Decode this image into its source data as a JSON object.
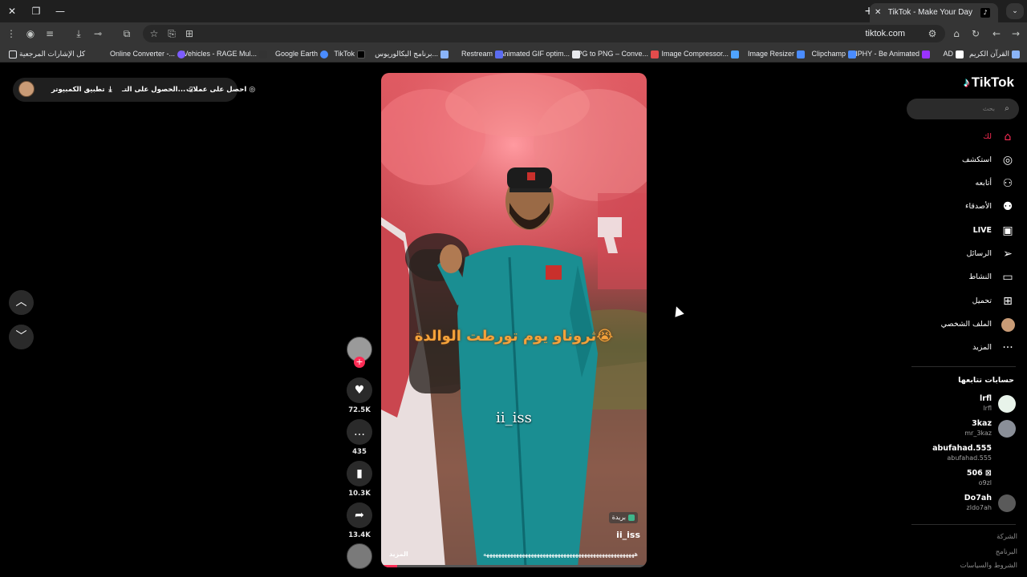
{
  "browser": {
    "tab_title": "TikTok - Make Your Day",
    "tab_favicon": "tiktok-icon",
    "url": "tiktok.com",
    "new_tab": "+",
    "tab_close": "✕"
  },
  "bookmarks": [
    {
      "label": "القرآن الكريم",
      "icon": "globe-icon",
      "color": "#8ab4f8"
    },
    {
      "label": "AD",
      "icon": "s-icon",
      "color": "#ffffff"
    },
    {
      "label": "GIPHY - Be Animated",
      "icon": "giphy-icon",
      "color": "#9933ff"
    },
    {
      "label": "Clipchamp",
      "icon": "clipchamp-icon",
      "color": "#4a8cff"
    },
    {
      "label": "Image Resizer",
      "icon": "resizer-icon",
      "color": "#e8eaed"
    },
    {
      "label": "Image Compressor...",
      "icon": "compressor-icon",
      "color": "#4fa3ff"
    },
    {
      "label": "JPG to PNG – Conve...",
      "icon": "convert-icon",
      "color": "#e34c4c"
    },
    {
      "label": "Animated GIF optim...",
      "icon": "gif-icon",
      "color": "#e8eaed"
    },
    {
      "label": "Restream",
      "icon": "restream-icon",
      "color": "#5b6cf0"
    },
    {
      "label": "برنامج البكالوريوس...",
      "icon": "edu-icon",
      "color": "#8ab4f8"
    },
    {
      "label": "TikTok",
      "icon": "tiktok-icon",
      "color": "#000000"
    },
    {
      "label": "Google Earth",
      "icon": "earth-icon",
      "color": "#4a8cff"
    },
    {
      "label": "Vehicles - RAGE Mul...",
      "icon": "rage-icon",
      "color": "#333333"
    },
    {
      "label": "Online Converter -...",
      "icon": "converter-icon",
      "color": "#7c5cff"
    },
    {
      "label": "كل الإشارات المرجعية",
      "icon": "folder-icon",
      "color": "#e8eaed"
    }
  ],
  "topbar": {
    "coins": "احصل على عملات",
    "get_app": "الحصول على التـ...",
    "desktop_app": "تطبيق الكمبيوتر"
  },
  "video": {
    "caption": "ثروناو يوم تورطت الوالدة😭",
    "watermark_handle": "ii_iss",
    "location": "بريدة",
    "author": "ii_iss",
    "description": "هههههههههههههههههههههههههههههههههههههههههههههههههههه",
    "more": "المزيد"
  },
  "actions": {
    "likes": "72.5K",
    "comments": "435",
    "saves": "10.3K",
    "shares": "13.4K",
    "follow_plus": "+"
  },
  "sidebar": {
    "logo": "TikTok",
    "search_placeholder": "بحث",
    "nav": [
      {
        "label": "لك",
        "icon": "home-icon",
        "active": true
      },
      {
        "label": "استكشف",
        "icon": "compass-icon",
        "active": false
      },
      {
        "label": "أتابعه",
        "icon": "following-icon",
        "active": false
      },
      {
        "label": "الأصدقاء",
        "icon": "friends-icon",
        "active": false
      },
      {
        "label": "LIVE",
        "icon": "live-icon",
        "active": false
      },
      {
        "label": "الرسائل",
        "icon": "messages-icon",
        "active": false
      },
      {
        "label": "النشاط",
        "icon": "activity-icon",
        "active": false
      },
      {
        "label": "تحميل",
        "icon": "upload-icon",
        "active": false
      },
      {
        "label": "الملف الشخصي",
        "icon": "profile-icon",
        "active": false
      },
      {
        "label": "المزيد",
        "icon": "more-icon",
        "active": false
      }
    ],
    "following_title": "حسابات تتابعها",
    "accounts": [
      {
        "name": "lrfl",
        "handle": "lrfl"
      },
      {
        "name": "3kaz",
        "handle": "mr_3kaz"
      },
      {
        "name": "abufahad.555",
        "handle": "abufahad.555"
      },
      {
        "name": "506 ⊠",
        "handle": "o9zl"
      },
      {
        "name": "Do7ah",
        "handle": "zldo7ah"
      }
    ],
    "footer": [
      "الشركة",
      "البرنامج",
      "الشروط والسياسات"
    ]
  }
}
